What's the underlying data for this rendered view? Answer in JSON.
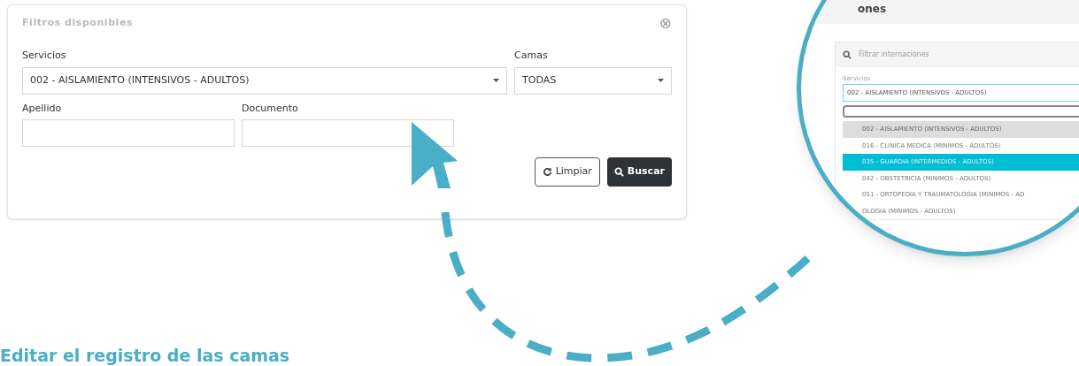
{
  "filter_panel": {
    "title": "Filtros disponibles",
    "close": "⊗",
    "fields": [
      {
        "kind": "select",
        "label": "Servicios",
        "value": "002 - AISLAMIENTO (INTENSIVOS - ADULTOS)"
      },
      {
        "kind": "select",
        "label": "Camas",
        "value": "TODAS"
      },
      {
        "kind": "text",
        "label": "Apellido"
      },
      {
        "kind": "text",
        "label": "Documento"
      }
    ],
    "buttons": [
      {
        "kind": "secondary",
        "label": "Limpiar"
      },
      {
        "kind": "primary",
        "label": "Buscar"
      }
    ]
  },
  "magnifier": {
    "title": "ones",
    "search_placeholder": "Filtrar internaciones",
    "label": "Servicios",
    "value": "002 - AISLAMIENTO (INTENSIVOS - ADULTOS)",
    "options": [
      {
        "label": "002 - AISLAMIENTO (INTENSIVOS - ADULTOS)",
        "selected": true,
        "hovered": false
      },
      {
        "label": "016 - CLINICA MEDICA (MINIMOS - ADULTOS)",
        "selected": false,
        "hovered": false
      },
      {
        "label": "035 - GUARDIA (INTERMEDIOS - ADULTOS)",
        "selected": false,
        "hovered": true
      },
      {
        "label": "042 - OBSTETRICIA (MINIMOS - ADULTOS)",
        "selected": false,
        "hovered": false
      },
      {
        "label": "051 - ORTOPEDIA Y TRAUMATOLOGIA (MINIMOS - AD",
        "selected": false,
        "hovered": false
      },
      {
        "label": "OLOGIA (MINIMOS - ADULTOS)",
        "selected": false,
        "hovered": false
      }
    ]
  },
  "heading": "Editar el registro de las camas"
}
